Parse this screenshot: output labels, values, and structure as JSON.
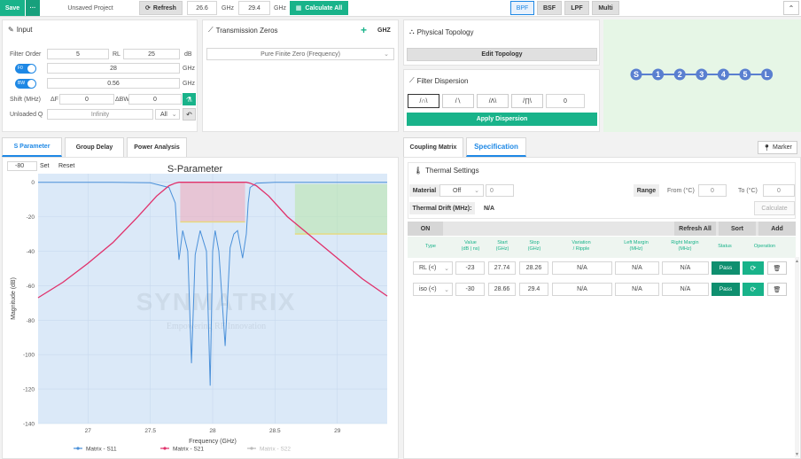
{
  "topbar": {
    "save_label": "Save",
    "more_label": "···",
    "project_name": "Unsaved Project",
    "refresh_label": "Refresh",
    "freq_start": "26.6",
    "freq_stop": "29.4",
    "unit": "GHz",
    "calc_label": "Calculate All",
    "filter_types": [
      "BPF",
      "BSF",
      "LPF",
      "Multi"
    ],
    "active_filter": "BPF",
    "collapse_icon": "chevron-up-icon"
  },
  "input": {
    "title": "Input",
    "filter_order_label": "Filter Order",
    "filter_order": "5",
    "rl_label": "RL",
    "rl_value": "25",
    "rl_unit": "dB",
    "f0_toggle": "F0",
    "f0_value": "28",
    "f0_unit": "GHz",
    "bw_toggle": "BW",
    "bw_value": "0.56",
    "bw_unit": "GHz",
    "shift_label": "Shift (MHz)",
    "df_label": "ΔF",
    "df_value": "0",
    "dbw_label": "ΔBW",
    "dbw_value": "0",
    "unloaded_q_label": "Unloaded Q",
    "unloaded_q_value": "Infinity",
    "unloaded_q_scope": "All"
  },
  "tz": {
    "title": "Transmission Zeros",
    "unit": "GHZ",
    "add_label": "+",
    "mode": "Pure Finite Zero (Frequency)"
  },
  "topology": {
    "title": "Physical Topology",
    "edit_label": "Edit Topology",
    "nodes": [
      "S",
      "1",
      "2",
      "3",
      "4",
      "5",
      "L"
    ]
  },
  "dispersion": {
    "title": "Filter Dispersion",
    "value": "0",
    "apply_label": "Apply Dispersion"
  },
  "left_tabs": [
    "S Parameter",
    "Group Delay",
    "Power Analysis"
  ],
  "plot_controls": {
    "value": "-80",
    "set_label": "Set",
    "reset_label": "Reset"
  },
  "watermark": {
    "name": "SYNMATRIX",
    "tagline": "Empowering RF Innovation"
  },
  "colors": {
    "accent": "#19b38a",
    "blue": "#1e88e5",
    "s11": "#4a90d9",
    "s21": "#e0306a",
    "s22": "#bbbbbb"
  },
  "chart_data": {
    "type": "line",
    "title": "S-Parameter",
    "xlabel": "Frequency (GHz)",
    "ylabel": "Magnitude (dB)",
    "xlim": [
      26.6,
      29.4
    ],
    "ylim": [
      -140,
      5
    ],
    "xticks": [
      27,
      27.5,
      28,
      28.5,
      29
    ],
    "yticks": [
      0,
      -20,
      -40,
      -60,
      -80,
      -100,
      -120,
      -140
    ],
    "series": [
      {
        "name": "Matrix - S11",
        "color": "#4a90d9",
        "x": [
          26.6,
          27.2,
          27.5,
          27.65,
          27.7,
          27.715,
          27.73,
          27.76,
          27.8,
          27.83,
          27.86,
          27.9,
          27.95,
          27.98,
          28.0,
          28.02,
          28.05,
          28.1,
          28.14,
          28.17,
          28.2,
          28.24,
          28.27,
          28.285,
          28.3,
          28.35,
          28.5,
          29.4
        ],
        "y": [
          0,
          0,
          -0.3,
          -3,
          -12,
          -30,
          -45,
          -28,
          -40,
          -105,
          -42,
          -28,
          -40,
          -118,
          -40,
          -28,
          -40,
          -95,
          -38,
          -30,
          -28,
          -44,
          -30,
          -12,
          -3,
          -0.5,
          0,
          0
        ]
      },
      {
        "name": "Matrix - S21",
        "color": "#e0306a",
        "x": [
          26.6,
          26.8,
          27.0,
          27.2,
          27.4,
          27.55,
          27.65,
          27.7,
          27.73,
          28.0,
          28.27,
          28.3,
          28.35,
          28.45,
          28.6,
          28.8,
          29.0,
          29.2,
          29.4
        ],
        "y": [
          -67,
          -58,
          -47,
          -35,
          -20,
          -8,
          -2,
          -0.5,
          0,
          0,
          0,
          -0.5,
          -2,
          -8,
          -20,
          -32,
          -44,
          -56,
          -66
        ]
      },
      {
        "name": "Matrix - S22",
        "color": "#bbbbbb",
        "x": [],
        "y": []
      }
    ],
    "masks": [
      {
        "x0": 27.74,
        "x1": 28.26,
        "y0": 0,
        "y1": -23,
        "color": "#f0a8b8"
      },
      {
        "x0": 28.66,
        "x1": 29.4,
        "y0": -1,
        "y1": -30,
        "color": "#b8e6a8"
      }
    ]
  },
  "right_tabs": [
    "Coupling Matrix",
    "Specification"
  ],
  "marker_label": "Marker",
  "thermal": {
    "title": "Thermal Settings",
    "material_label": "Material",
    "material_value": "Off",
    "material_num": "0",
    "range_label": "Range",
    "from_label": "From (°C)",
    "from_value": "0",
    "to_label": "To (°C)",
    "to_value": "0",
    "drift_label": "Thermal Drift (MHz):",
    "drift_value": "N/A",
    "calc_label": "Calculate"
  },
  "spec": {
    "on_label": "ON",
    "refresh_label": "Refresh All",
    "sort_label": "Sort",
    "add_label": "Add",
    "headers": [
      "Type",
      "Value\n(dB | ns)",
      "Start\n(GHz)",
      "Stop\n(GHz)",
      "Variation\n/ Ripple",
      "Left Margin\n(MHz)",
      "Right Margin\n(MHz)",
      "Status",
      "Operation"
    ],
    "rows": [
      {
        "type": "RL (<)",
        "value": "-23",
        "start": "27.74",
        "stop": "28.26",
        "variation": "N/A",
        "left": "N/A",
        "right": "N/A",
        "status": "Pass"
      },
      {
        "type": "iso (<)",
        "value": "-30",
        "start": "28.66",
        "stop": "29.4",
        "variation": "N/A",
        "left": "N/A",
        "right": "N/A",
        "status": "Pass"
      }
    ]
  }
}
